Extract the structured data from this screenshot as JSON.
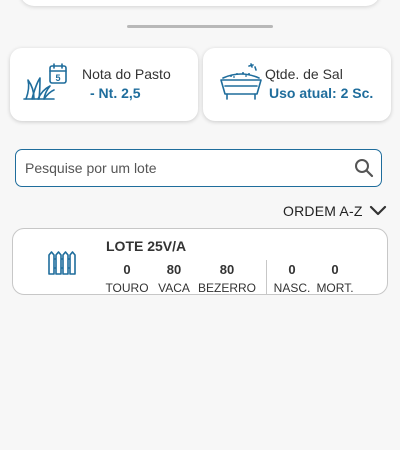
{
  "stats": {
    "pasture": {
      "title": "Nota do Pasto",
      "value": "- Nt. 2,5",
      "icon_day": "5",
      "icon": "calendar-grass-icon"
    },
    "salt": {
      "title": "Qtde. de Sal",
      "value": "Uso atual: 2 Sc.",
      "icon": "salt-trough-icon"
    }
  },
  "search": {
    "placeholder": "Pesquise por um lote",
    "value": ""
  },
  "sort": {
    "label": "ORDEM A-Z"
  },
  "lot": {
    "title": "LOTE 25V/A",
    "metrics": [
      {
        "value": "0",
        "label": "TOURO"
      },
      {
        "value": "80",
        "label": "VACA"
      },
      {
        "value": "80",
        "label": "BEZERRO"
      },
      {
        "value": "0",
        "label": "NASC."
      },
      {
        "value": "0",
        "label": "MORT."
      }
    ]
  },
  "colors": {
    "accent": "#1f6d9c",
    "background": "#f7f7f7"
  }
}
